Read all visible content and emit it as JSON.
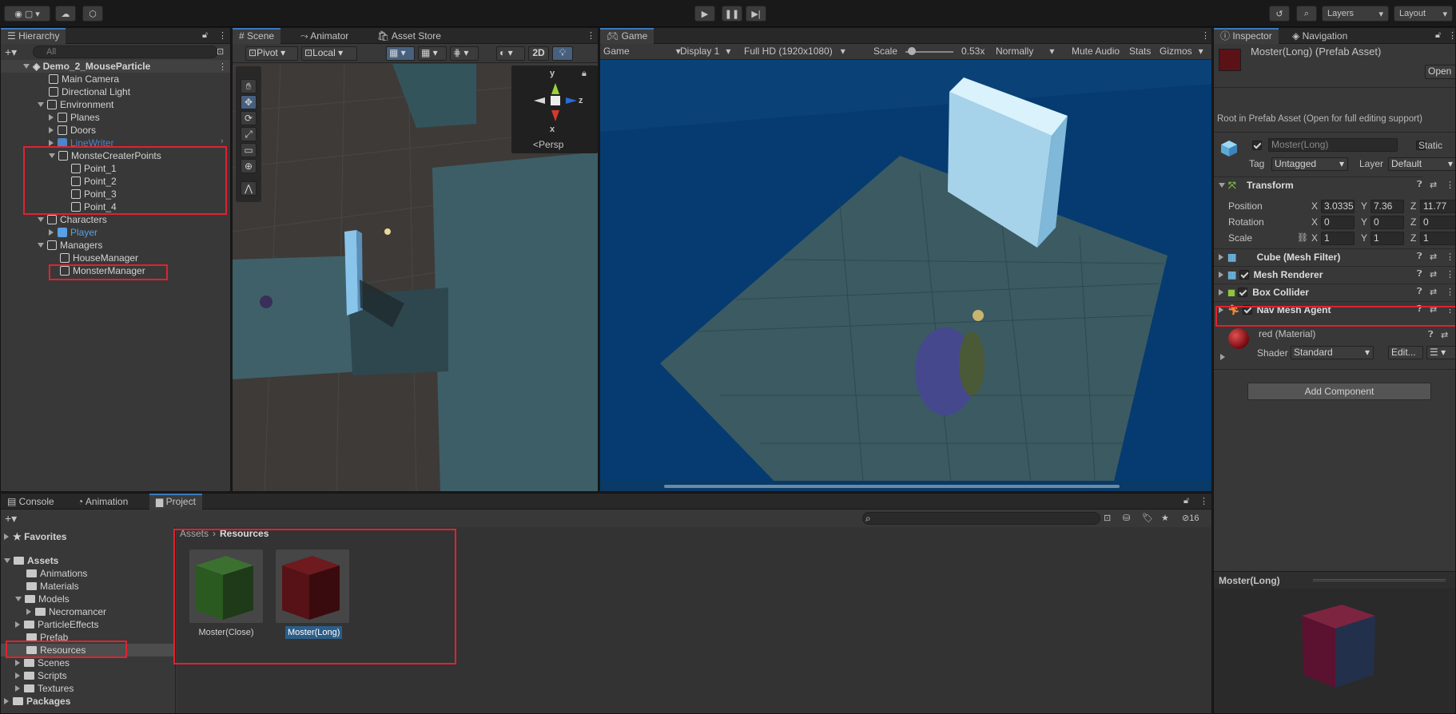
{
  "toolbar": {
    "account": "●",
    "layers": "Layers",
    "layout": "Layout"
  },
  "hierarchy": {
    "tab": "Hierarchy",
    "search_placeholder": "All",
    "items": [
      {
        "label": "Demo_2_MouseParticle"
      },
      {
        "label": "Main Camera"
      },
      {
        "label": "Directional Light"
      },
      {
        "label": "Environment"
      },
      {
        "label": "Planes"
      },
      {
        "label": "Doors"
      },
      {
        "label": "LineWriter"
      },
      {
        "label": "MonsteCreaterPoints"
      },
      {
        "label": "Point_1"
      },
      {
        "label": "Point_2"
      },
      {
        "label": "Point_3"
      },
      {
        "label": "Point_4"
      },
      {
        "label": "Characters"
      },
      {
        "label": "Player"
      },
      {
        "label": "Managers"
      },
      {
        "label": "HouseManager"
      },
      {
        "label": "MonsterManager"
      }
    ]
  },
  "scene": {
    "tabs": [
      "Scene",
      "Animator",
      "Asset Store"
    ],
    "pivot": "Pivot",
    "local": "Local",
    "two_d": "2D",
    "persp": "Persp",
    "gizmo": {
      "y": "y",
      "z": "z",
      "x": "x"
    }
  },
  "game": {
    "tab": "Game",
    "mode": "Game",
    "display": "Display 1",
    "resolution": "Full HD (1920x1080)",
    "scale_label": "Scale",
    "scale_value": "0.53x",
    "play_mode": "Normally",
    "mute": "Mute Audio",
    "stats": "Stats",
    "gizmos": "Gizmos"
  },
  "inspector": {
    "tabs": [
      "Inspector",
      "Navigation"
    ],
    "title": "Moster(Long) (Prefab Asset)",
    "open": "Open",
    "root_note": "Root in Prefab Asset (Open for full editing support)",
    "name": "Moster(Long)",
    "static": "Static",
    "tag_label": "Tag",
    "tag": "Untagged",
    "layer_label": "Layer",
    "layer": "Default",
    "transform": "Transform",
    "position_label": "Position",
    "rotation_label": "Rotation",
    "scale_label": "Scale",
    "axis": {
      "x": "X",
      "y": "Y",
      "z": "Z"
    },
    "position": {
      "x": "3.0335",
      "y": "7.36",
      "z": "11.77"
    },
    "rotation": {
      "x": "0",
      "y": "0",
      "z": "0"
    },
    "scale": {
      "x": "1",
      "y": "1",
      "z": "1"
    },
    "components": [
      "Cube (Mesh Filter)",
      "Mesh Renderer",
      "Box Collider",
      "Nav Mesh Agent"
    ],
    "material": "red (Material)",
    "shader_label": "Shader",
    "shader": "Standard",
    "edit": "Edit...",
    "add_component": "Add Component",
    "preview_title": "Moster(Long)"
  },
  "project": {
    "tabs": [
      "Console",
      "Animation",
      "Project"
    ],
    "count": "16",
    "favorites": "Favorites",
    "tree": [
      "Assets",
      "Animations",
      "Materials",
      "Models",
      "Necromancer",
      "ParticleEffects",
      "Prefab",
      "Resources",
      "Scenes",
      "Scripts",
      "Textures",
      "Packages"
    ],
    "breadcrumb": [
      "Assets",
      "Resources"
    ],
    "assets": [
      {
        "label": "Moster(Close)",
        "color": "#2f5a1e"
      },
      {
        "label": "Moster(Long)",
        "color": "#5a1216"
      }
    ]
  }
}
